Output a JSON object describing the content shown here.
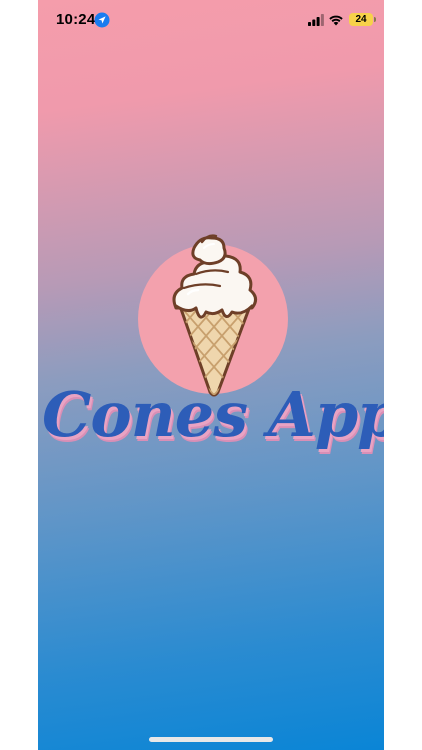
{
  "status_bar": {
    "time": "10:24",
    "battery_level": "24",
    "icons": [
      "location-arrow-icon",
      "cellular-signal-icon",
      "wifi-icon",
      "battery-icon"
    ]
  },
  "splash": {
    "app_name": "Cones App",
    "logo_icon": "ice-cream-cone-icon"
  },
  "colors": {
    "gradient_top": "#f59dab",
    "gradient_bottom": "#0a85d6",
    "logo_circle": "#f3a1ad",
    "title_text": "#2d5db8",
    "title_shadow": "#e9a3c3",
    "battery": "#f7d24a"
  }
}
